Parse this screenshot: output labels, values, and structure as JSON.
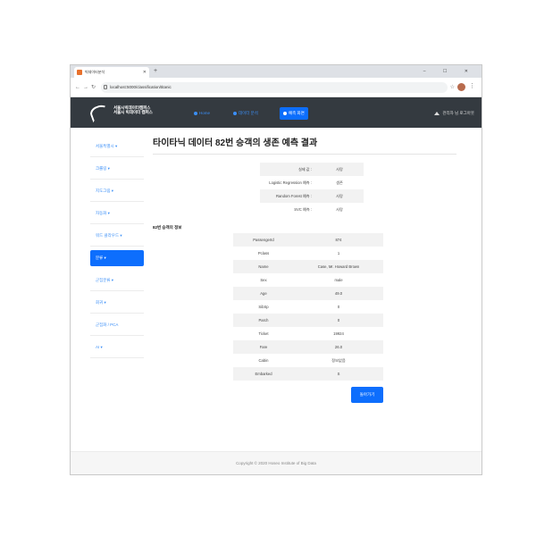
{
  "browser": {
    "tab_title": "빅데이터분석",
    "url": "localhost:5000/classification/titanic",
    "window_controls": "–  ☐  ✕"
  },
  "navbar": {
    "logo_line1": "서울시빅데이터캠퍼스",
    "logo_line2": "서울시 빅데이터 캠퍼스",
    "items": [
      {
        "label": "Home",
        "active": false
      },
      {
        "label": "데이터 분석",
        "active": false
      },
      {
        "label": "예측 화면",
        "active": true
      }
    ],
    "user": "관리자 님 로그아웃"
  },
  "sidebar": {
    "items": [
      {
        "label": "서울특별시 ▾",
        "active": false
      },
      {
        "label": "크롤링 ▾",
        "active": false
      },
      {
        "label": "지도그림 ▾",
        "active": false
      },
      {
        "label": "자동화 ▾",
        "active": false
      },
      {
        "label": "워드 클라우드 ▾",
        "active": false
      },
      {
        "label": "분류 ▾",
        "active": true
      },
      {
        "label": "군집분류 ▾",
        "active": false
      },
      {
        "label": "회귀 ▾",
        "active": false
      },
      {
        "label": "군집화 / PCA",
        "active": false
      },
      {
        "label": "AI ▾",
        "active": false
      }
    ]
  },
  "main": {
    "title": "타이타닉 데이터 82번 승객의 생존 예측 결과",
    "predictions": [
      {
        "label": "실제 값 :",
        "value": "사망"
      },
      {
        "label": "Logistic Regression 예측 :",
        "value": "생존"
      },
      {
        "label": "Random Forest 예측 :",
        "value": "사망"
      },
      {
        "label": "SVC 예측 :",
        "value": "사망"
      }
    ],
    "section_label": "82번 승객의 정보",
    "passenger": [
      {
        "key": "PassengerId",
        "value": "874"
      },
      {
        "key": "Pclass",
        "value": "1"
      },
      {
        "key": "Name",
        "value": "Case, Mr. Howard Brown"
      },
      {
        "key": "Sex",
        "value": "male"
      },
      {
        "key": "Age",
        "value": "49.0"
      },
      {
        "key": "SibSp",
        "value": "0"
      },
      {
        "key": "Parch",
        "value": "0"
      },
      {
        "key": "Ticket",
        "value": "19924"
      },
      {
        "key": "Fare",
        "value": "26.0"
      },
      {
        "key": "Cabin",
        "value": "정보없음"
      },
      {
        "key": "Embarked",
        "value": "S"
      }
    ],
    "back_button": "돌아가기"
  },
  "footer": {
    "text": "Copyright © 2020 Hoseo Institute of Big Data"
  }
}
